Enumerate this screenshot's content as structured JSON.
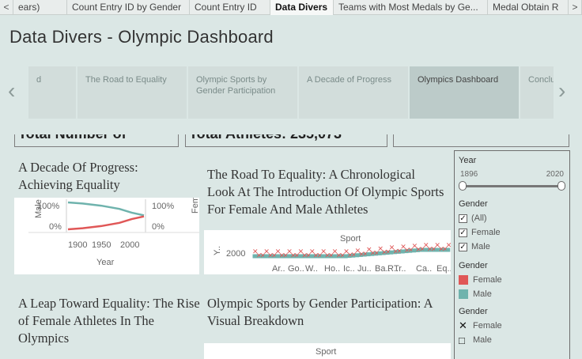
{
  "tabs": [
    {
      "label": "ears)"
    },
    {
      "label": "Count Entry ID by Gender"
    },
    {
      "label": "Count Entry ID"
    },
    {
      "label": "Data Divers"
    },
    {
      "label": "Teams with Most Medals by Ge..."
    },
    {
      "label": "Medal Obtain R"
    }
  ],
  "nav": {
    "prev": "<",
    "next": ">"
  },
  "dashboard_title": "Data Divers -  Olympic Dashboard",
  "story_arrows": {
    "left": "‹",
    "right": "›"
  },
  "story_points": [
    {
      "label": "d"
    },
    {
      "label": "The Road to Equality"
    },
    {
      "label": "Olympic Sports by Gender Participation"
    },
    {
      "label": "A Decade of Progress"
    },
    {
      "label": "Olympics Dashboard"
    },
    {
      "label": "Conclu"
    }
  ],
  "kpis": [
    {
      "text": "Total Number of"
    },
    {
      "text": "Total Athletes: 235,073"
    },
    {
      "text": ""
    }
  ],
  "sections": {
    "decade": "A Decade Of Progress: Achieving Equality",
    "road": "The Road To Equality: A Chronological Look At The Introduction Of Olympic Sports For Female And Male Athletes",
    "leap": "A Leap Toward Equality: The Rise of Female Athletes In The Olympics",
    "sports": "Olympic Sports by Gender Participation: A Visual Breakdown"
  },
  "decade_chart": {
    "y_left_label": "Male P..",
    "y_right_label": "Femal..",
    "y_ticks": [
      "100%",
      "0%"
    ],
    "x_ticks": [
      "1900",
      "1950",
      "2000"
    ],
    "xlabel": "Year"
  },
  "road_chart": {
    "title": "Sport",
    "ylabel": "Y..",
    "y_tick": "2000",
    "x_ticks": [
      "Ar..",
      "Go..",
      "W..",
      "Ho..",
      "Ic..",
      "Ju..",
      "Ba..",
      "R..",
      "Tr..",
      "Ca..",
      "Eq.."
    ]
  },
  "sports_chart": {
    "title": "Sport"
  },
  "filters": {
    "year": {
      "title": "Year",
      "min": "1896",
      "max": "2020"
    },
    "gender_filter": {
      "title": "Gender",
      "options": [
        {
          "label": "(All)",
          "checked": "✓"
        },
        {
          "label": "Female",
          "checked": "✓"
        },
        {
          "label": "Male",
          "checked": "✓"
        }
      ]
    },
    "gender_color": {
      "title": "Gender",
      "items": [
        {
          "label": "Female",
          "color": "#e05757"
        },
        {
          "label": "Male",
          "color": "#6fb3ad"
        }
      ]
    },
    "gender_shape": {
      "title": "Gender",
      "items": [
        {
          "label": "Female",
          "symbol": "✕"
        },
        {
          "label": "Male",
          "symbol": "□"
        }
      ]
    }
  },
  "chart_data": [
    {
      "type": "line",
      "title": "",
      "xlabel": "Year",
      "ylabel": "Male P.. / Femal..",
      "x": [
        1896,
        1920,
        1950,
        1980,
        2000,
        2020
      ],
      "series": [
        {
          "name": "Male",
          "values": [
            100,
            96,
            88,
            76,
            62,
            52
          ],
          "color": "#6fb3ad"
        },
        {
          "name": "Female",
          "values": [
            0,
            4,
            12,
            24,
            38,
            48
          ],
          "color": "#e05757"
        }
      ],
      "ylim": [
        0,
        100
      ]
    },
    {
      "type": "scatter",
      "title": "Sport",
      "xlabel": "",
      "ylabel": "Y..",
      "categories": [
        "Ar..",
        "Go..",
        "W..",
        "Ho..",
        "Ic..",
        "Ju..",
        "Ba..",
        "R..",
        "Tr..",
        "Ca..",
        "Eq.."
      ]
    }
  ]
}
